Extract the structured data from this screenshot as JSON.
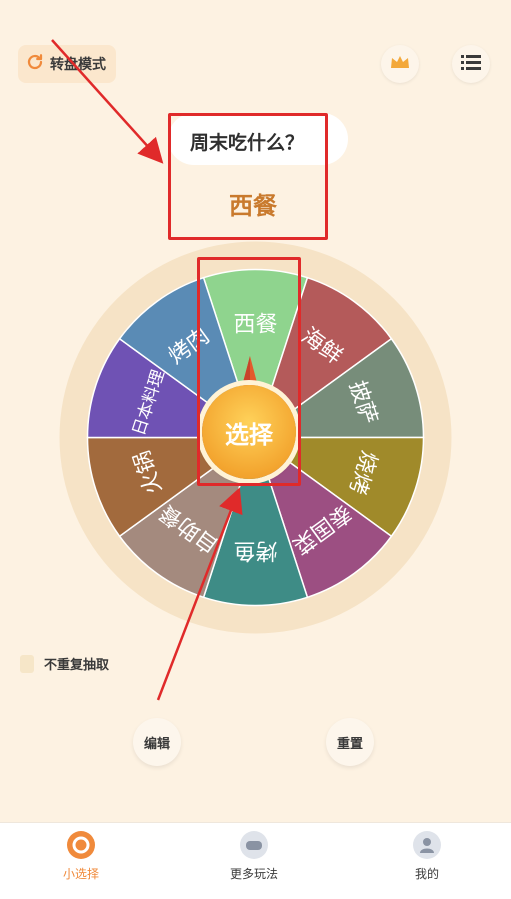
{
  "mode_button": {
    "label": "转盘模式",
    "icon": "refresh-icon"
  },
  "top_icons": {
    "vip": "crown-icon",
    "list": "list-icon"
  },
  "prompt": {
    "question": "周末吃什么？",
    "result": "西餐"
  },
  "wheel": {
    "segments": [
      {
        "label": "西餐",
        "color": "#8fd48e"
      },
      {
        "label": "海鲜",
        "color": "#b45a5a"
      },
      {
        "label": "披萨",
        "color": "#778d7a"
      },
      {
        "label": "烧烤",
        "color": "#a08a2a"
      },
      {
        "label": "泰国菜",
        "color": "#9c4f82"
      },
      {
        "label": "烤鱼",
        "color": "#3e8c86"
      },
      {
        "label": "自助餐",
        "color": "#a48a7e"
      },
      {
        "label": "火锅",
        "color": "#a26a3d"
      },
      {
        "label": "日本料理",
        "color": "#6f52b4"
      },
      {
        "label": "烤肉",
        "color": "#5a8bb5"
      }
    ],
    "center_label": "选择"
  },
  "no_repeat": {
    "label": "不重复抽取"
  },
  "buttons": {
    "edit": "编辑",
    "reset": "重置"
  },
  "nav": [
    {
      "label": "小选择",
      "active": true,
      "icon": "target-icon"
    },
    {
      "label": "更多玩法",
      "active": false,
      "icon": "game-icon"
    },
    {
      "label": "我的",
      "active": false,
      "icon": "user-icon"
    }
  ],
  "colors": {
    "accent": "#f08a3b",
    "highlight": "#e02a2a"
  }
}
